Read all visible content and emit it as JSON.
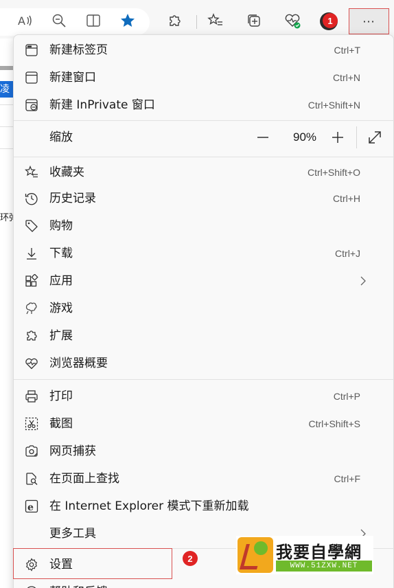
{
  "page_left": {
    "highlight_text": "凌",
    "fragment_text": "环弹"
  },
  "toolbar": {
    "more_label": "···"
  },
  "badges": {
    "one": "1",
    "two": "2"
  },
  "menu": {
    "new_tab": {
      "label": "新建标签页",
      "shortcut": "Ctrl+T"
    },
    "new_window": {
      "label": "新建窗口",
      "shortcut": "Ctrl+N"
    },
    "new_inprivate": {
      "label": "新建 InPrivate 窗口",
      "shortcut": "Ctrl+Shift+N"
    },
    "zoom": {
      "label": "缩放",
      "value": "90%"
    },
    "favorites": {
      "label": "收藏夹",
      "shortcut": "Ctrl+Shift+O"
    },
    "history": {
      "label": "历史记录",
      "shortcut": "Ctrl+H"
    },
    "shopping": {
      "label": "购物"
    },
    "downloads": {
      "label": "下载",
      "shortcut": "Ctrl+J"
    },
    "apps": {
      "label": "应用"
    },
    "games": {
      "label": "游戏"
    },
    "extensions": {
      "label": "扩展"
    },
    "browser_essentials": {
      "label": "浏览器概要"
    },
    "print": {
      "label": "打印",
      "shortcut": "Ctrl+P"
    },
    "screenshot": {
      "label": "截图",
      "shortcut": "Ctrl+Shift+S"
    },
    "web_capture": {
      "label": "网页捕获"
    },
    "find": {
      "label": "在页面上查找",
      "shortcut": "Ctrl+F"
    },
    "ie_mode": {
      "label": "在 Internet Explorer 模式下重新加载"
    },
    "more_tools": {
      "label": "更多工具"
    },
    "settings": {
      "label": "设置"
    },
    "help": {
      "label": "帮助和反馈"
    }
  },
  "watermark": {
    "title": "我要自學網",
    "url": "WWW.51ZXW.NET"
  },
  "colors": {
    "accent_blue": "#0f6cbd",
    "badge_red": "#e02424",
    "highlight_border": "#d95050"
  }
}
